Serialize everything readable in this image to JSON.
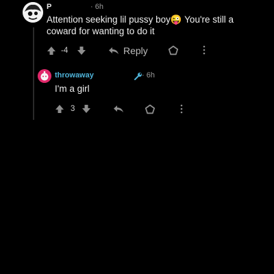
{
  "comment": {
    "username": "P",
    "time": "· 6h",
    "text": "Attention seeking lil pussy boy😜 You're still a coward for wanting to do it",
    "vote_count": "-4",
    "reply_label": "Reply",
    "icons": [
      "upvote-icon",
      "downvote-icon",
      "reply-icon",
      "award-icon",
      "more-icon"
    ]
  },
  "reply": {
    "username": "throwaway",
    "time": "· 6h",
    "text": "I'm a girl",
    "vote_count": "3",
    "icons": [
      "mod-tool-icon",
      "upvote-icon",
      "downvote-icon",
      "reply-icon",
      "award-icon",
      "more-icon"
    ]
  },
  "colors": {
    "background": "#000000",
    "reply_username": "#4fb3d9",
    "reply_avatar": "#e0286a"
  }
}
